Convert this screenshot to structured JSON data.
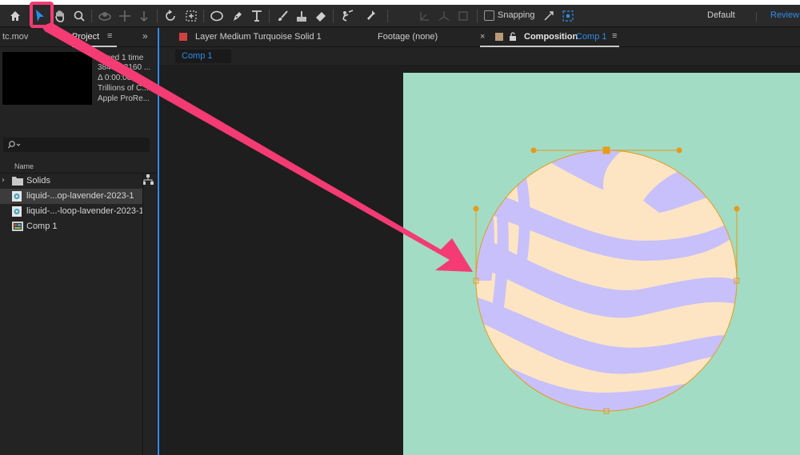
{
  "toolbar": {
    "snapping_label": "Snapping",
    "workspace_default": "Default",
    "workspace_review": "Review",
    "tools": [
      "home-icon",
      "selection-icon",
      "hand-icon",
      "zoom-icon",
      "orbit-icon",
      "pan-behind-icon",
      "dolly-icon",
      "rotate-icon",
      "anchor-icon",
      "ellipse-icon",
      "pen-icon",
      "type-icon",
      "brush-icon",
      "stamp-icon",
      "eraser-icon",
      "roto-icon",
      "puppet-icon",
      "snap-icon"
    ],
    "active_tool": "selection-icon"
  },
  "project_panel": {
    "tab_footage": "tc.mov",
    "tab_project": "Project",
    "info": ", used 1 time",
    "info_lines": [
      "3840 x 2160 ...",
      "Δ 0:00:08...",
      "Trillions of C...",
      "Apple ProRe..."
    ],
    "column_name": "Name",
    "items": [
      {
        "label": "Solids",
        "icon": "folder-icon",
        "selected": false
      },
      {
        "label": "liquid-...op-lavender-2023-1",
        "icon": "footage-icon",
        "selected": true
      },
      {
        "label": "liquid-...-loop-lavender-2023-1",
        "icon": "footage-icon",
        "selected": false
      },
      {
        "label": "Comp 1",
        "icon": "composition-icon",
        "selected": false
      }
    ]
  },
  "comp_panel": {
    "tab_layer": "Layer Medium Turquoise Solid 1",
    "tab_footage": "Footage (none)",
    "tab_comp_prefix": "Composition",
    "tab_comp_name": "Comp 1",
    "breadcrumb": "Comp 1"
  },
  "colors": {
    "accent": "#2d8ceb",
    "canvas_bg": "#a2dcc4",
    "lavender": "#c7c0fa",
    "cream": "#fde5c4",
    "path_orange": "#e89a18",
    "annotation_pink": "#f43b74"
  }
}
